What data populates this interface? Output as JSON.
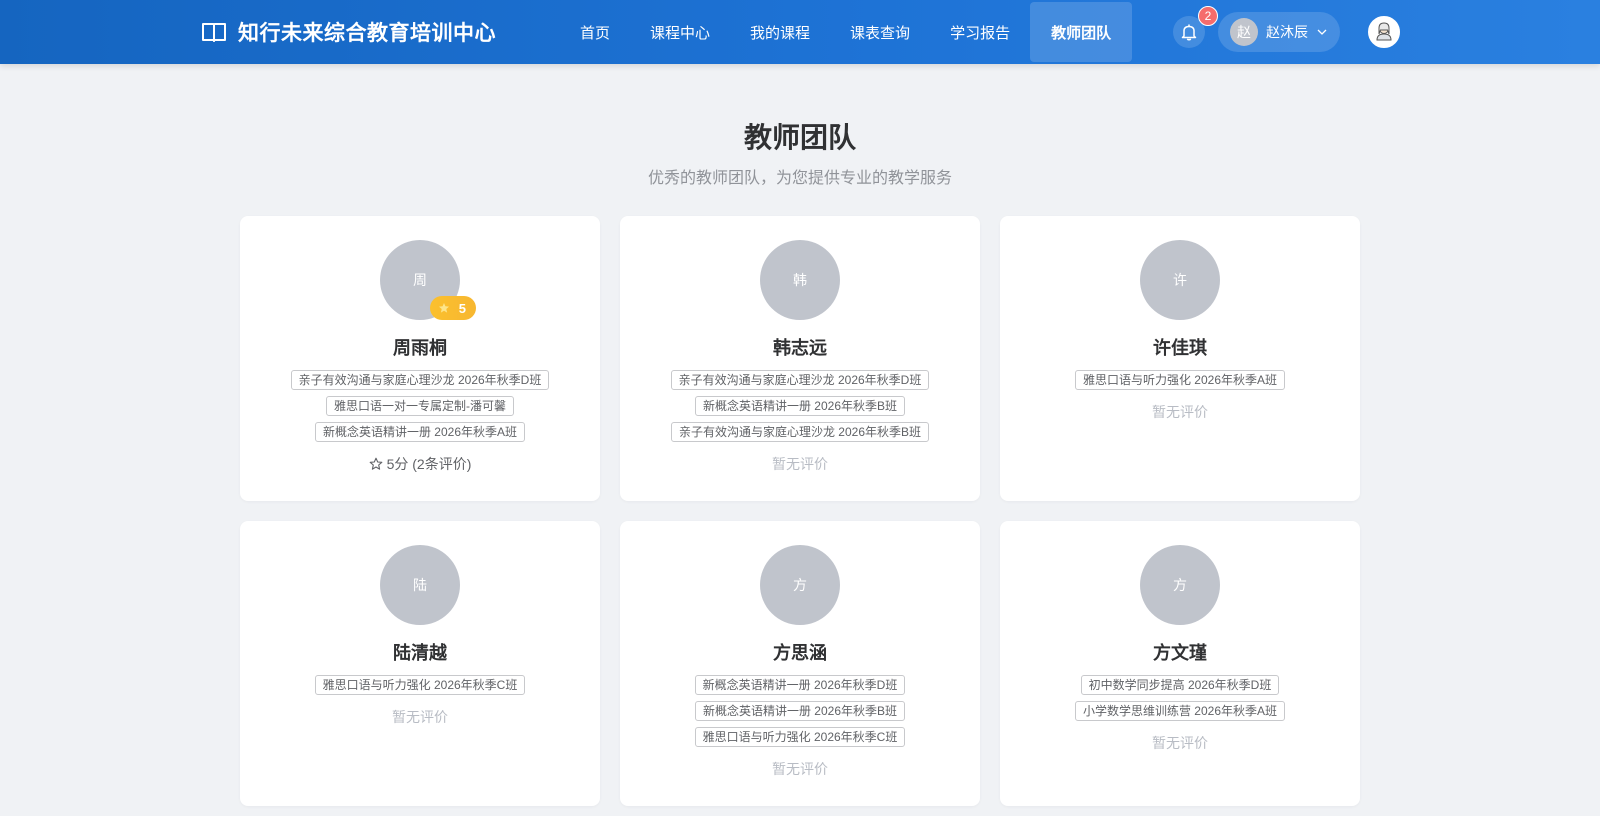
{
  "header": {
    "brand_title": "知行未来综合教育培训中心",
    "nav": [
      {
        "label": "首页",
        "active": false
      },
      {
        "label": "课程中心",
        "active": false
      },
      {
        "label": "我的课程",
        "active": false
      },
      {
        "label": "课表查询",
        "active": false
      },
      {
        "label": "学习报告",
        "active": false
      },
      {
        "label": "教师团队",
        "active": true
      }
    ],
    "notification_count": "2",
    "user": {
      "avatar_char": "赵",
      "name": "赵沐辰"
    }
  },
  "page": {
    "title": "教师团队",
    "subtitle": "优秀的教师团队，为您提供专业的教学服务"
  },
  "teachers": [
    {
      "avatar_char": "周",
      "name": "周雨桐",
      "badge": "5",
      "courses": [
        "亲子有效沟通与家庭心理沙龙 2026年秋季D班",
        "雅思口语一对一专属定制-潘可馨",
        "新概念英语精讲一册 2026年秋季A班"
      ],
      "rating_text": "5分 (2条评价)"
    },
    {
      "avatar_char": "韩",
      "name": "韩志远",
      "courses": [
        "亲子有效沟通与家庭心理沙龙 2026年秋季D班",
        "新概念英语精讲一册 2026年秋季B班",
        "亲子有效沟通与家庭心理沙龙 2026年秋季B班"
      ],
      "no_rating_text": "暂无评价"
    },
    {
      "avatar_char": "许",
      "name": "许佳琪",
      "courses": [
        "雅思口语与听力强化 2026年秋季A班"
      ],
      "no_rating_text": "暂无评价"
    },
    {
      "avatar_char": "陆",
      "name": "陆清越",
      "courses": [
        "雅思口语与听力强化 2026年秋季C班"
      ],
      "no_rating_text": "暂无评价"
    },
    {
      "avatar_char": "方",
      "name": "方思涵",
      "courses": [
        "新概念英语精讲一册 2026年秋季D班",
        "新概念英语精讲一册 2026年秋季B班",
        "雅思口语与听力强化 2026年秋季C班"
      ],
      "no_rating_text": "暂无评价"
    },
    {
      "avatar_char": "方",
      "name": "方文瑾",
      "courses": [
        "初中数学同步提高 2026年秋季D班",
        "小学数学思维训练营 2026年秋季A班"
      ],
      "no_rating_text": "暂无评价"
    }
  ],
  "colors": {
    "header": "#1e73d6",
    "badge_red": "#f56c6c",
    "rating_gold": "#fbc02d",
    "avatar_gray": "#c0c4cc"
  }
}
